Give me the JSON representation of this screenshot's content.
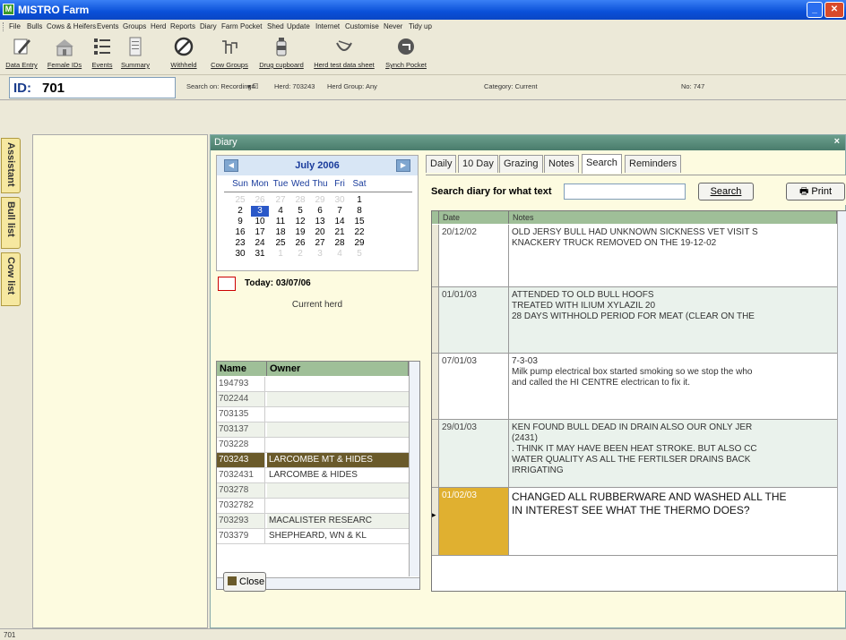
{
  "window": {
    "title": "MISTRO Farm"
  },
  "menu": [
    "File",
    "Bulls",
    "Cows & Heifers",
    "Events",
    "Groups",
    "Herd",
    "Reports",
    "Diary",
    "Farm",
    "Pocket",
    "Shed",
    "Update",
    "Internet",
    "Customise",
    "Never",
    "Tidy up"
  ],
  "toolbar": [
    {
      "label": "Data Entry",
      "icon": "pencil-icon"
    },
    {
      "label": "Female IDs",
      "icon": "barn-icon"
    },
    {
      "label": "Events",
      "icon": "list-icon"
    },
    {
      "label": "Summary",
      "icon": "document-icon"
    },
    {
      "label": "Withheld",
      "icon": "prohibited-icon"
    },
    {
      "label": "Cow Groups",
      "icon": "cows-icon"
    },
    {
      "label": "Drug cupboard",
      "icon": "bottle-icon"
    },
    {
      "label": "Herd test data sheet",
      "icon": "udder-icon"
    },
    {
      "label": "Synch Pocket",
      "icon": "sync-icon"
    }
  ],
  "idbar": {
    "id_label": "ID:",
    "id_value": "701",
    "search_on": "Search on: Recording#",
    "herd": "Herd: 703243",
    "herd_group": "Herd Group: Any",
    "category": "Category: Current",
    "count": "No: 747"
  },
  "side_tabs": [
    "Assistant",
    "Bull list",
    "Cow list"
  ],
  "diary": {
    "title": "Diary",
    "close_x": "×",
    "calendar": {
      "month": "July 2006",
      "prev": "◀",
      "next": "▶",
      "dow": [
        "Sun",
        "Mon",
        "Tue",
        "Wed",
        "Thu",
        "Fri",
        "Sat"
      ],
      "weeks": [
        [
          "25",
          "26",
          "27",
          "28",
          "29",
          "30",
          "1"
        ],
        [
          "2",
          "3",
          "4",
          "5",
          "6",
          "7",
          "8"
        ],
        [
          "9",
          "10",
          "11",
          "12",
          "13",
          "14",
          "15"
        ],
        [
          "16",
          "17",
          "18",
          "19",
          "20",
          "21",
          "22"
        ],
        [
          "23",
          "24",
          "25",
          "26",
          "27",
          "28",
          "29"
        ],
        [
          "30",
          "31",
          "1",
          "2",
          "3",
          "4",
          "5"
        ]
      ],
      "selected_day": "3",
      "today": "Today: 03/07/06"
    },
    "current_herd": "Current herd",
    "herd_table": {
      "headers": [
        "Name",
        "Owner"
      ],
      "rows": [
        [
          "194793",
          ""
        ],
        [
          "702244",
          ""
        ],
        [
          "703135",
          ""
        ],
        [
          "703137",
          ""
        ],
        [
          "703228",
          ""
        ],
        [
          "703243",
          "LARCOMBE MT & HIDES"
        ],
        [
          "7032431",
          "LARCOMBE & HIDES"
        ],
        [
          "703278",
          ""
        ],
        [
          "7032782",
          ""
        ],
        [
          "703293",
          "MACALISTER RESEARC"
        ],
        [
          "703379",
          "SHEPHEARD, WN & KL"
        ]
      ],
      "selected_index": 5
    },
    "close_button": "Close",
    "tabs": [
      "Daily",
      "10 Day",
      "Grazing",
      "Notes",
      "Search",
      "Reminders"
    ],
    "active_tab": "Search",
    "search_label": "Search diary for what text",
    "search_value": "",
    "search_button": "Search",
    "print_button": "Print",
    "notes_table": {
      "headers": [
        "Date",
        "Notes"
      ],
      "rows": [
        {
          "date": "20/12/02",
          "note": "OLD JERSY BULL HAD UNKNOWN SICKNESS VET VISIT S\nKNACKERY TRUCK REMOVED ON THE 19-12-02"
        },
        {
          "date": "01/01/03",
          "note": "ATTENDED TO OLD BULL HOOFS\nTREATED WITH ILIUM XYLAZIL 20\n28 DAYS WITHHOLD PERIOD FOR MEAT (CLEAR ON THE"
        },
        {
          "date": "07/01/03",
          "note": "7-3-03\nMilk pump electrical box started smoking so we stop the who\nand called the HI CENTRE electrican to fix it."
        },
        {
          "date": "29/01/03",
          "note": "KEN FOUND BULL DEAD IN DRAIN ALSO OUR ONLY JER\n(2431)\n. THINK IT MAY HAVE BEEN HEAT STROKE. BUT ALSO CC\nWATER QUALITY AS ALL THE FERTILSER DRAINS BACK\nIRRIGATING"
        },
        {
          "date": "01/02/03",
          "note": "CHANGED ALL RUBBERWARE AND WASHED ALL THE\nIN INTEREST SEE WHAT THE THERMO DOES?"
        }
      ]
    }
  },
  "status": {
    "left": "701"
  },
  "colors": {
    "titlebar": "#0a50d8",
    "grid_header": "#9fbf98",
    "selected_row": "#6a5a2a",
    "current_date": "#e0b030",
    "side_tab": "#f6e8a0"
  }
}
